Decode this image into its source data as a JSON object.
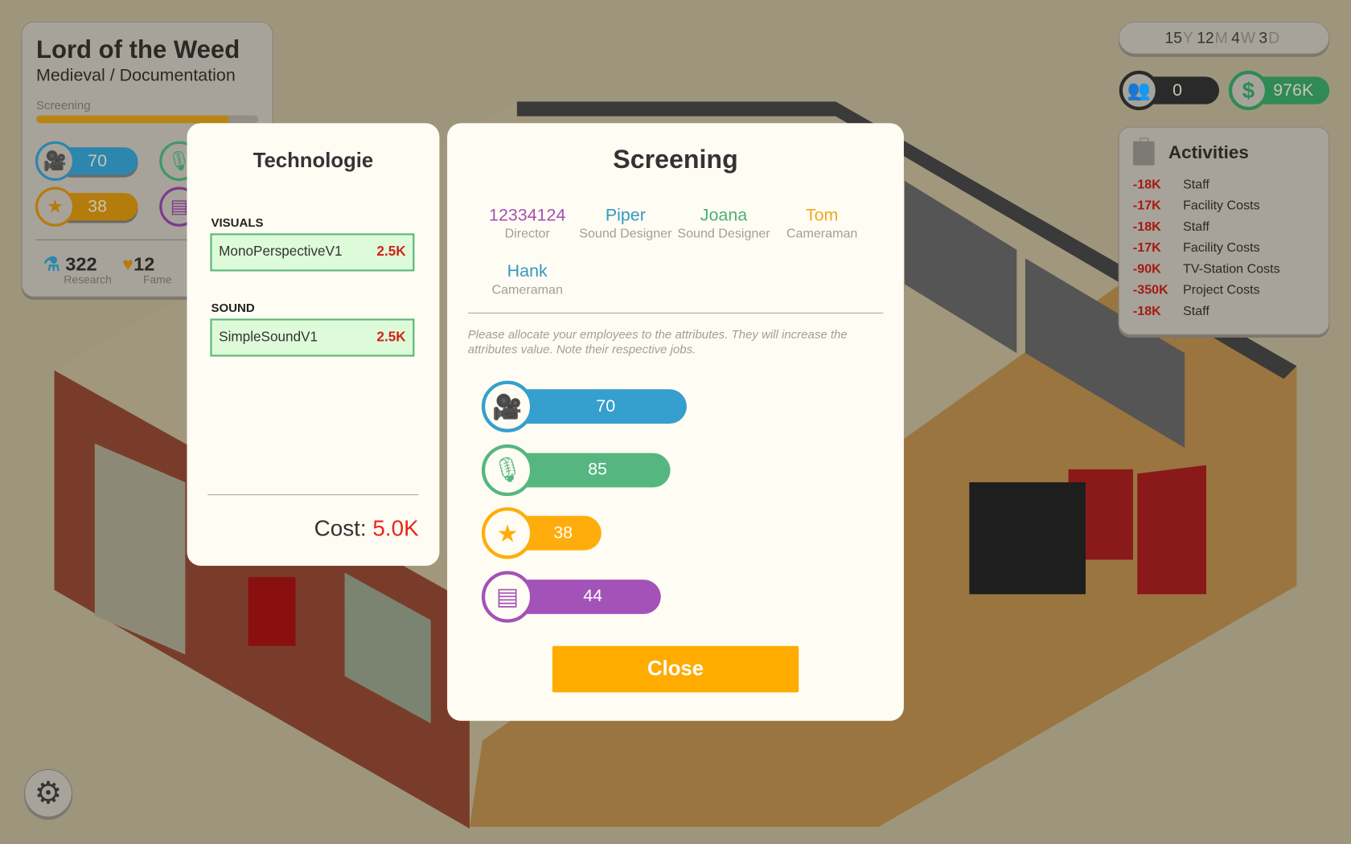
{
  "project": {
    "title": "Lord of the Weed",
    "genre": "Medieval / Documentation",
    "phase": "Screening",
    "progress_pct": 87,
    "attributes": [
      {
        "icon": "camera-icon",
        "value": "70"
      },
      {
        "icon": "microphone-icon",
        "value": ""
      },
      {
        "icon": "star-icon",
        "value": "38"
      },
      {
        "icon": "notebook-icon",
        "value": ""
      }
    ],
    "research": {
      "value": "322",
      "label": "Research"
    },
    "fame": {
      "value": "12",
      "label": "Fame"
    }
  },
  "date": {
    "years": "15",
    "y": "Y",
    "months": "12",
    "m": "M",
    "weeks": "4",
    "w": "W",
    "days": "3",
    "d": "D"
  },
  "fans": {
    "value": "0"
  },
  "money": {
    "value": "976K",
    "symbol": "$"
  },
  "activities": {
    "title": "Activities",
    "items": [
      {
        "amount": "-18K",
        "label": "Staff"
      },
      {
        "amount": "-17K",
        "label": "Facility Costs"
      },
      {
        "amount": "-18K",
        "label": "Staff"
      },
      {
        "amount": "-17K",
        "label": "Facility Costs"
      },
      {
        "amount": "-90K",
        "label": "TV-Station Costs"
      },
      {
        "amount": "-350K",
        "label": "Project Costs"
      },
      {
        "amount": "-18K",
        "label": "Staff"
      }
    ]
  },
  "tech": {
    "title": "Technologie",
    "visuals_label": "VISUALS",
    "visuals": {
      "name": "MonoPerspectiveV1",
      "cost": "2.5K"
    },
    "sound_label": "SOUND",
    "sound": {
      "name": "SimpleSoundV1",
      "cost": "2.5K"
    },
    "cost_label": "Cost:",
    "cost": "5.0K"
  },
  "screening": {
    "title": "Screening",
    "employees": [
      {
        "name": "12334124",
        "job": "Director",
        "color": "#a44fb7"
      },
      {
        "name": "Piper",
        "job": "Sound Designer",
        "color": "#3598c3"
      },
      {
        "name": "Joana",
        "job": "Sound Designer",
        "color": "#4caf74"
      },
      {
        "name": "Tom",
        "job": "Cameraman",
        "color": "#f5a623"
      },
      {
        "name": "Hank",
        "job": "Cameraman",
        "color": "#3598c3"
      }
    ],
    "hint": "Please allocate your employees to the attributes. They will increase the attributes value. Note their respective jobs.",
    "attributes": [
      {
        "icon": "camera-icon",
        "value": "70",
        "color": "#359fcd"
      },
      {
        "icon": "microphone-icon",
        "value": "85",
        "color": "#55b77f"
      },
      {
        "icon": "star-icon",
        "value": "38",
        "color": "#ffad0d"
      },
      {
        "icon": "notebook-icon",
        "value": "44",
        "color": "#a352b8"
      }
    ],
    "close_label": "Close"
  }
}
